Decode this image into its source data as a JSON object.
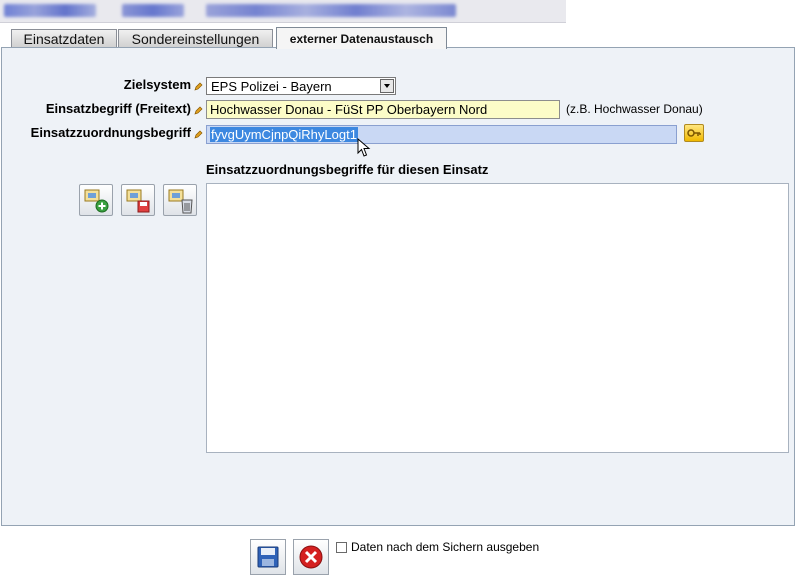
{
  "tabs": [
    {
      "label": "Einsatzdaten"
    },
    {
      "label": "Sondereinstellungen"
    },
    {
      "label": "externer Datenaustausch",
      "active": true
    }
  ],
  "form": {
    "zielsystem_label": "Zielsystem",
    "zielsystem_value": "EPS Polizei - Bayern",
    "einsatzbegriff_label": "Einsatzbegriff (Freitext)",
    "einsatzbegriff_value": "Hochwasser Donau - FüSt PP Oberbayern Nord",
    "einsatzbegriff_hint": "(z.B. Hochwasser Donau)",
    "zuordnung_label": "Einsatzzuordnungsbegriff",
    "zuordnung_value": "fyvgUymCjnpQiRhyLogt1"
  },
  "list": {
    "title": "Einsatzzuordnungsbegriffe für diesen Einsatz",
    "items": []
  },
  "footer": {
    "checkbox_label": "Daten nach dem Sichern ausgeben",
    "checkbox_checked": false
  },
  "icons": {
    "required": "pencil-icon",
    "generate": "key-icon",
    "add": "add-icon",
    "save": "save-icon",
    "delete": "delete-icon",
    "cancel": "cancel-icon"
  },
  "colors": {
    "panel_bg": "#eef2f7",
    "freitext_bg": "#fcfcc8",
    "focused_bg": "#c9d8f4",
    "cancel_red": "#d42020"
  }
}
